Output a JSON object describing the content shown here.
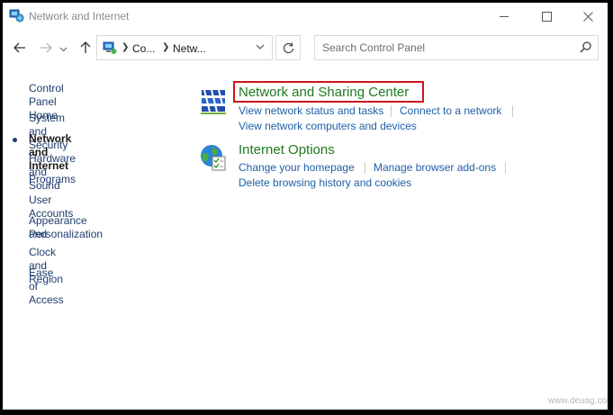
{
  "window": {
    "title": "Network and Internet"
  },
  "address": {
    "crumbs": [
      "Co...",
      "Netw..."
    ]
  },
  "search": {
    "placeholder": "Search Control Panel"
  },
  "sidebar": {
    "items": [
      {
        "label": "Control Panel Home"
      },
      {
        "label": "System and Security"
      },
      {
        "label": "Network and Internet",
        "current": true
      },
      {
        "label": "Hardware and Sound"
      },
      {
        "label": "Programs"
      },
      {
        "label": "User Accounts"
      },
      {
        "label": "Appearance and",
        "label2": "Personalization"
      },
      {
        "label": "Clock and Region"
      },
      {
        "label": "Ease of Access"
      }
    ]
  },
  "categories": [
    {
      "title": "Network and Sharing Center",
      "icon": "network-sharing-icon",
      "links": [
        "View network status and tasks",
        "Connect to a network",
        "View network computers and devices"
      ]
    },
    {
      "title": "Internet Options",
      "icon": "internet-options-icon",
      "links": [
        "Change your homepage",
        "Manage browser add-ons",
        "Delete browsing history and cookies"
      ]
    }
  ],
  "colors": {
    "category_title": "#1e7a1e",
    "link": "#1f5fa8",
    "highlight_border": "#d0161b"
  },
  "watermark": "www.deuag.com"
}
